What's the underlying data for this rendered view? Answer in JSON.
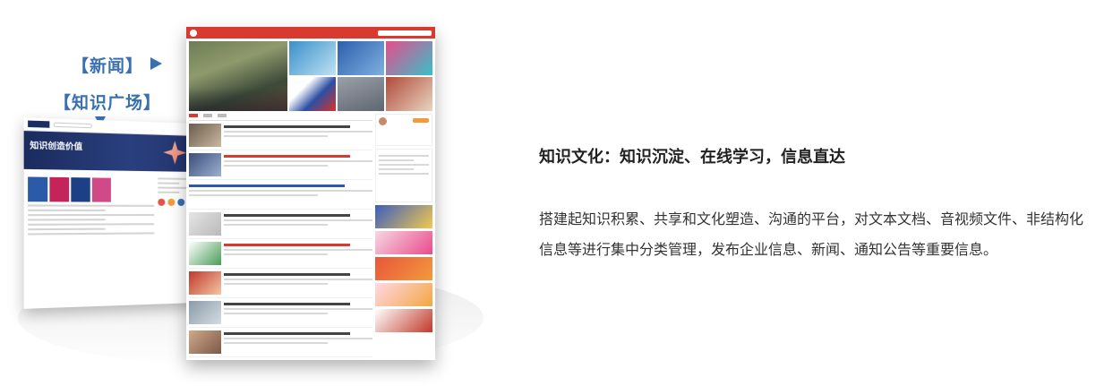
{
  "callouts": {
    "news_label": "【新闻】",
    "knowledge_label": "【知识广场】"
  },
  "knowledge_screen": {
    "banner_title": "知识创造价值"
  },
  "feature": {
    "title": "知识文化：知识沉淀、在线学习，信息直达",
    "description": "搭建起知识积累、共享和文化塑造、沟通的平台，对文本文档、音视频文件、非结构化信息等进行集中分类管理，发布企业信息、新闻、通知公告等重要信息。"
  },
  "colors": {
    "accent_blue": "#3a6fb0",
    "news_red": "#d83a30",
    "kb_navy": "#1b2b5e",
    "ad_orange": "#f39a3c"
  },
  "icons": {
    "news_arrow": "arrow-right-icon",
    "knowledge_arrow": "arrow-down-icon"
  }
}
